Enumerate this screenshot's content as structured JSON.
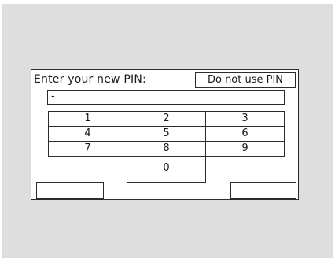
{
  "prompt": "Enter your new PIN:",
  "no_pin_button": "Do not use PIN",
  "pin_value": "-",
  "keypad": [
    "1",
    "2",
    "3",
    "4",
    "5",
    "6",
    "7",
    "8",
    "9",
    "0"
  ],
  "left_button": "",
  "right_button": ""
}
